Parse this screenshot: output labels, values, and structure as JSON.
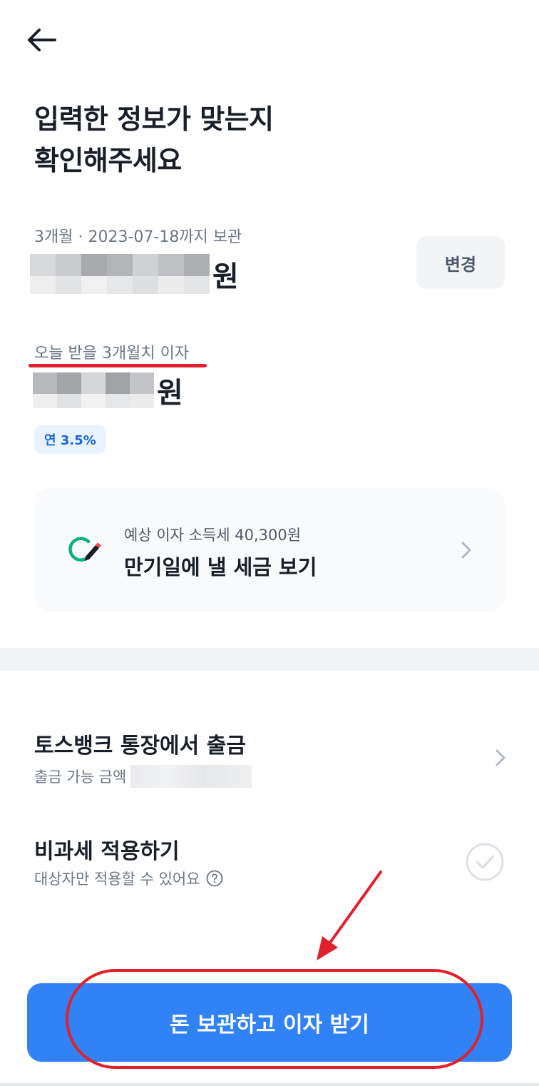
{
  "header": {
    "title_line1": "입력한 정보가 맞는지",
    "title_line2": "확인해주세요"
  },
  "deposit": {
    "period_text": "3개월 · 2023-07-18까지 보관",
    "amount_suffix": "원",
    "change_label": "변경"
  },
  "interest": {
    "label": "오늘 받을 3개월치 이자",
    "amount_suffix": "원",
    "rate_badge": "연 3.5%"
  },
  "tax_card": {
    "subtitle": "예상 이자 소득세 40,300원",
    "title": "만기일에 낼 세금 보기"
  },
  "withdraw": {
    "title": "토스뱅크 통장에서 출금",
    "subtitle": "출금 가능 금액"
  },
  "tax_free": {
    "title": "비과세 적용하기",
    "subtitle": "대상자만 적용할 수 있어요",
    "checked": false
  },
  "cta": {
    "label": "돈 보관하고 이자 받기"
  },
  "colors": {
    "primary": "#3182f6",
    "annotation_red": "#e0202b",
    "badge_bg": "#e8f3ff",
    "badge_text": "#1b64da",
    "tax_icon_green": "#0cb07f"
  },
  "icons": {
    "back": "arrow-left-icon",
    "tax": "edit-pencil-icon",
    "chevron": "chevron-right-icon",
    "help": "question-circle-icon",
    "check": "check-circle-icon"
  }
}
